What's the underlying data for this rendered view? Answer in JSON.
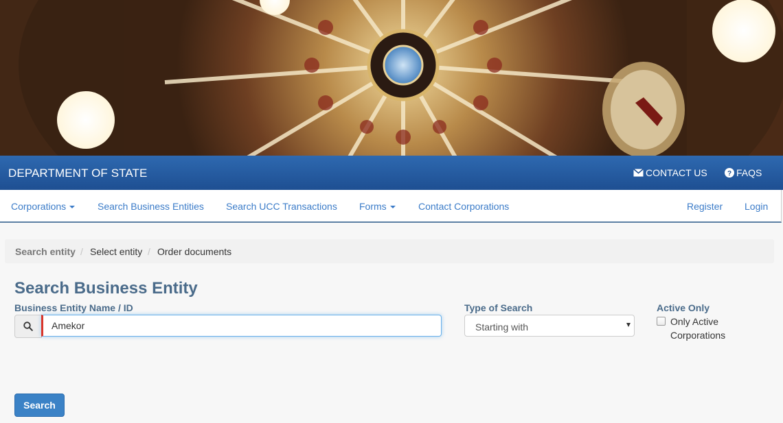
{
  "header": {
    "brand": "DEPARTMENT OF STATE",
    "contact_label": "CONTACT US",
    "faqs_label": "FAQS",
    "colors": {
      "primary_blue": "#2a5fa5",
      "link_blue": "#3a7bc8",
      "title_slate": "#4a6b8a",
      "button_blue": "#3b82c6",
      "error_red": "#d9352b"
    }
  },
  "nav": {
    "corporations": "Corporations",
    "search_entities": "Search Business Entities",
    "search_ucc": "Search UCC Transactions",
    "forms": "Forms",
    "contact_corporations": "Contact Corporations",
    "register": "Register",
    "login": "Login"
  },
  "breadcrumb": {
    "step1": "Search entity",
    "step2": "Select entity",
    "step3": "Order documents",
    "separator": "/"
  },
  "search": {
    "title": "Search Business Entity",
    "name_label": "Business Entity Name / ID",
    "name_value": "Amekor",
    "type_label": "Type of Search",
    "type_value": "Starting with",
    "active_label": "Active Only",
    "active_checkbox_label": "Only Active Corporations",
    "active_checked": false,
    "button_label": "Search",
    "search_icon": "search-icon"
  }
}
